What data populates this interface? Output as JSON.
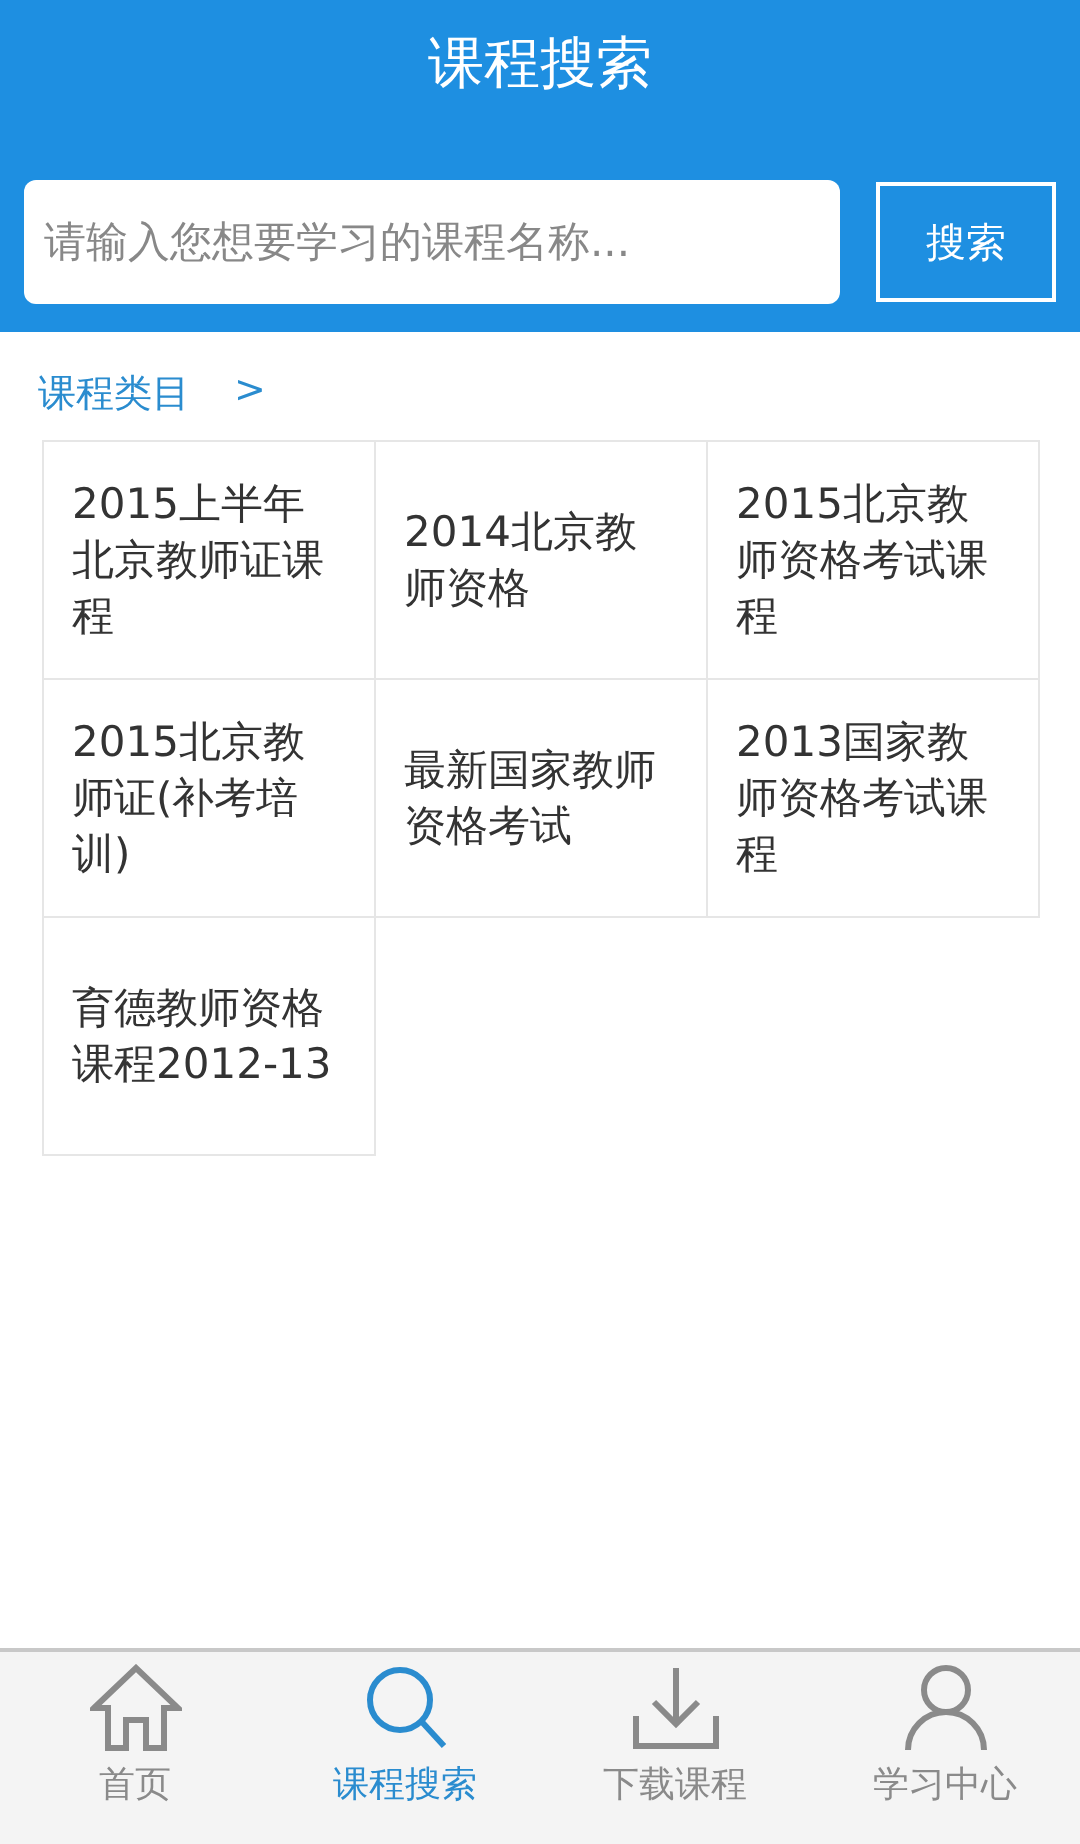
{
  "header": {
    "title": "课程搜索"
  },
  "search": {
    "placeholder": "请输入您想要学习的课程名称...",
    "button": "搜索"
  },
  "breadcrumb": {
    "label": "课程类目",
    "arrow": ">"
  },
  "categories": [
    {
      "label": "2015上半年北京教师证课程"
    },
    {
      "label": "2014北京教师资格"
    },
    {
      "label": "2015北京教师资格考试课程"
    },
    {
      "label": "2015北京教师证(补考培训)"
    },
    {
      "label": "最新国家教师资格考试"
    },
    {
      "label": "2013国家教师资格考试课程"
    },
    {
      "label": "育德教师资格课程2012-13"
    }
  ],
  "tabs": [
    {
      "label": "首页",
      "selected": false
    },
    {
      "label": "课程搜索",
      "selected": true
    },
    {
      "label": "下载课程",
      "selected": false
    },
    {
      "label": "学习中心",
      "selected": false
    }
  ]
}
